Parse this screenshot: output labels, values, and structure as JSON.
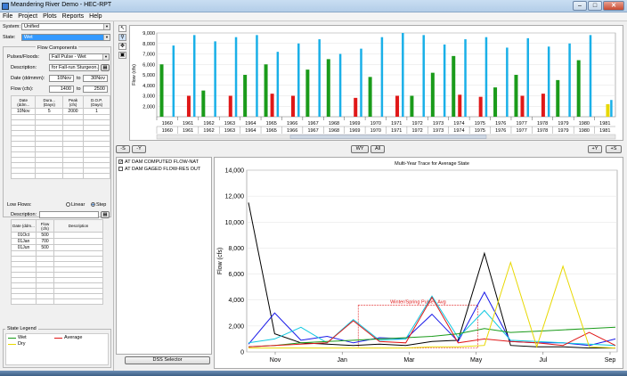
{
  "window": {
    "title": "Meandering River Demo - HEC-RPT"
  },
  "menu": [
    "File",
    "Project",
    "Plots",
    "Reports",
    "Help"
  ],
  "system": {
    "label": "System:",
    "value": "Unified"
  },
  "state": {
    "label": "State:",
    "value": "Wet"
  },
  "flow_components": {
    "title": "Flow Components",
    "pulses_label": "Pulses/Floods:",
    "pulses_value": "Fall Pulse - Wet",
    "description_label": "Description:",
    "description_value": "for Fall-run Sturgeon...",
    "date_label": "Date (ddmmm):",
    "date_from": "10Nov",
    "date_to_label": "to",
    "date_to": "30Nov",
    "flow_label": "Flow (cfs):",
    "flow_from": "1400",
    "flow_to_label": "to",
    "flow_to": "2500",
    "table": {
      "headers": [
        "Date (ddm...",
        "Dura... (Days)",
        "Peak (cfs)",
        "D.O.P. (Days)"
      ],
      "rows": [
        [
          "10Nov",
          "5",
          "2000",
          "1"
        ]
      ]
    }
  },
  "low_flows": {
    "label": "Low Flows:",
    "linear_label": "Linear",
    "step_label": "Step",
    "selected": "Step",
    "description_label": "Description:",
    "table": {
      "headers": [
        "Date (ddm...",
        "Flow (cfs)",
        "Description"
      ],
      "rows": [
        [
          "01Oct",
          "500",
          ""
        ],
        [
          "01Jan",
          "700",
          ""
        ],
        [
          "01Jun",
          "500",
          ""
        ]
      ]
    }
  },
  "state_legend": {
    "title": "State Legend",
    "items": [
      {
        "label": "Wet",
        "color": "#1a9b1a"
      },
      {
        "label": "Average",
        "color": "#e01818"
      },
      {
        "label": "Dry",
        "color": "#e8d800"
      }
    ]
  },
  "top_toolbar": {
    "left_buttons": [
      "-S",
      "-Y"
    ],
    "center_buttons": [
      "WY",
      "All"
    ],
    "right_buttons": [
      "+Y",
      "+S"
    ]
  },
  "dss": {
    "items": [
      {
        "label": "AT DAM COMPUTED FLOW-NAT",
        "checked": true
      },
      {
        "label": "AT DAM GAGED FLOW-RES OUT",
        "checked": false
      }
    ],
    "button": "DSS Selector"
  },
  "colors": {
    "wet": "#1a9b1a",
    "average": "#e01818",
    "dry": "#e8d800",
    "dss_blue": "#1ab0e8"
  },
  "chart_data": [
    {
      "type": "bar",
      "title": "",
      "ylabel": "Flow (cfs)",
      "ylim": [
        1000,
        9000
      ],
      "yticks": [
        "9,000",
        "8,000",
        "7,000",
        "6,000",
        "5,000",
        "4,000",
        "3,000",
        "2,000"
      ],
      "x_years_top": [
        "1960",
        "1961",
        "1962",
        "1963",
        "1964",
        "1965",
        "1966",
        "1967",
        "1968",
        "1969",
        "1970",
        "1971",
        "1972",
        "1973",
        "1974",
        "1975",
        "1976",
        "1977",
        "1978",
        "1979",
        "1980",
        "1981"
      ],
      "x_years_bottom": [
        "1960",
        "1961",
        "1962",
        "1963",
        "1964",
        "1965",
        "1966",
        "1967",
        "1968",
        "1969",
        "1970",
        "1971",
        "1972",
        "1973",
        "1974",
        "1975",
        "1976",
        "1977",
        "1978",
        "1979",
        "1980",
        "1981"
      ],
      "series": [
        {
          "name": "Wet",
          "values": [
            6000,
            0,
            3500,
            0,
            5000,
            6000,
            0,
            5500,
            6500,
            0,
            4800,
            0,
            3000,
            5200,
            6800,
            0,
            3800,
            5000,
            0,
            4500,
            6400,
            0
          ]
        },
        {
          "name": "Average",
          "values": [
            0,
            3000,
            0,
            3000,
            0,
            3200,
            3000,
            0,
            0,
            2800,
            0,
            3000,
            0,
            0,
            3100,
            2900,
            0,
            3000,
            3200,
            0,
            0,
            0
          ]
        },
        {
          "name": "Dry",
          "values": [
            0,
            0,
            0,
            0,
            0,
            0,
            0,
            0,
            0,
            0,
            0,
            0,
            0,
            0,
            0,
            0,
            0,
            0,
            0,
            0,
            0,
            2200
          ]
        },
        {
          "name": "DSS",
          "values": [
            7800,
            8800,
            8200,
            8600,
            8800,
            7200,
            8000,
            8400,
            7000,
            7500,
            8600,
            9000,
            8800,
            7900,
            8400,
            8600,
            7600,
            8500,
            7700,
            8000,
            8800,
            2600
          ]
        }
      ]
    },
    {
      "type": "line",
      "title": "Multi-Year Trace for Average State",
      "xlabel": "",
      "ylabel": "Flow (cfs)",
      "ylim": [
        0,
        14000
      ],
      "yticks": [
        "14,000",
        "12,000",
        "10,000",
        "8,000",
        "6,000",
        "4,000",
        "2,000",
        "0"
      ],
      "xticks": [
        "Nov",
        "Jan",
        "Mar",
        "May",
        "Jul",
        "Sep"
      ],
      "annotation": "Winter/Spring Pulse - Avg",
      "series": [
        {
          "name": "black",
          "color": "#000000",
          "values": [
            11500,
            1400,
            700,
            600,
            500,
            600,
            500,
            800,
            900,
            7600,
            500,
            400,
            400,
            300,
            300
          ]
        },
        {
          "name": "blue",
          "color": "#1a1ae8",
          "values": [
            600,
            3000,
            900,
            1200,
            700,
            1100,
            1000,
            2900,
            800,
            4600,
            800,
            700,
            700,
            500,
            1000
          ]
        },
        {
          "name": "cyan",
          "color": "#10c8e0",
          "values": [
            700,
            1000,
            1900,
            700,
            2500,
            900,
            1000,
            4300,
            1100,
            3200,
            900,
            800,
            700,
            600,
            500
          ]
        },
        {
          "name": "green",
          "color": "#1a9b1a",
          "values": [
            400,
            500,
            700,
            800,
            900,
            1000,
            1100,
            1200,
            1400,
            1800,
            1500,
            1600,
            1700,
            1800,
            1900
          ]
        },
        {
          "name": "red",
          "color": "#e01818",
          "values": [
            400,
            500,
            600,
            700,
            2400,
            800,
            700,
            4200,
            700,
            1000,
            800,
            700,
            500,
            1500,
            500
          ]
        },
        {
          "name": "yellow",
          "color": "#e8d800",
          "values": [
            300,
            300,
            300,
            300,
            300,
            300,
            300,
            400,
            400,
            500,
            6900,
            400,
            6600,
            400,
            300
          ]
        }
      ]
    }
  ]
}
